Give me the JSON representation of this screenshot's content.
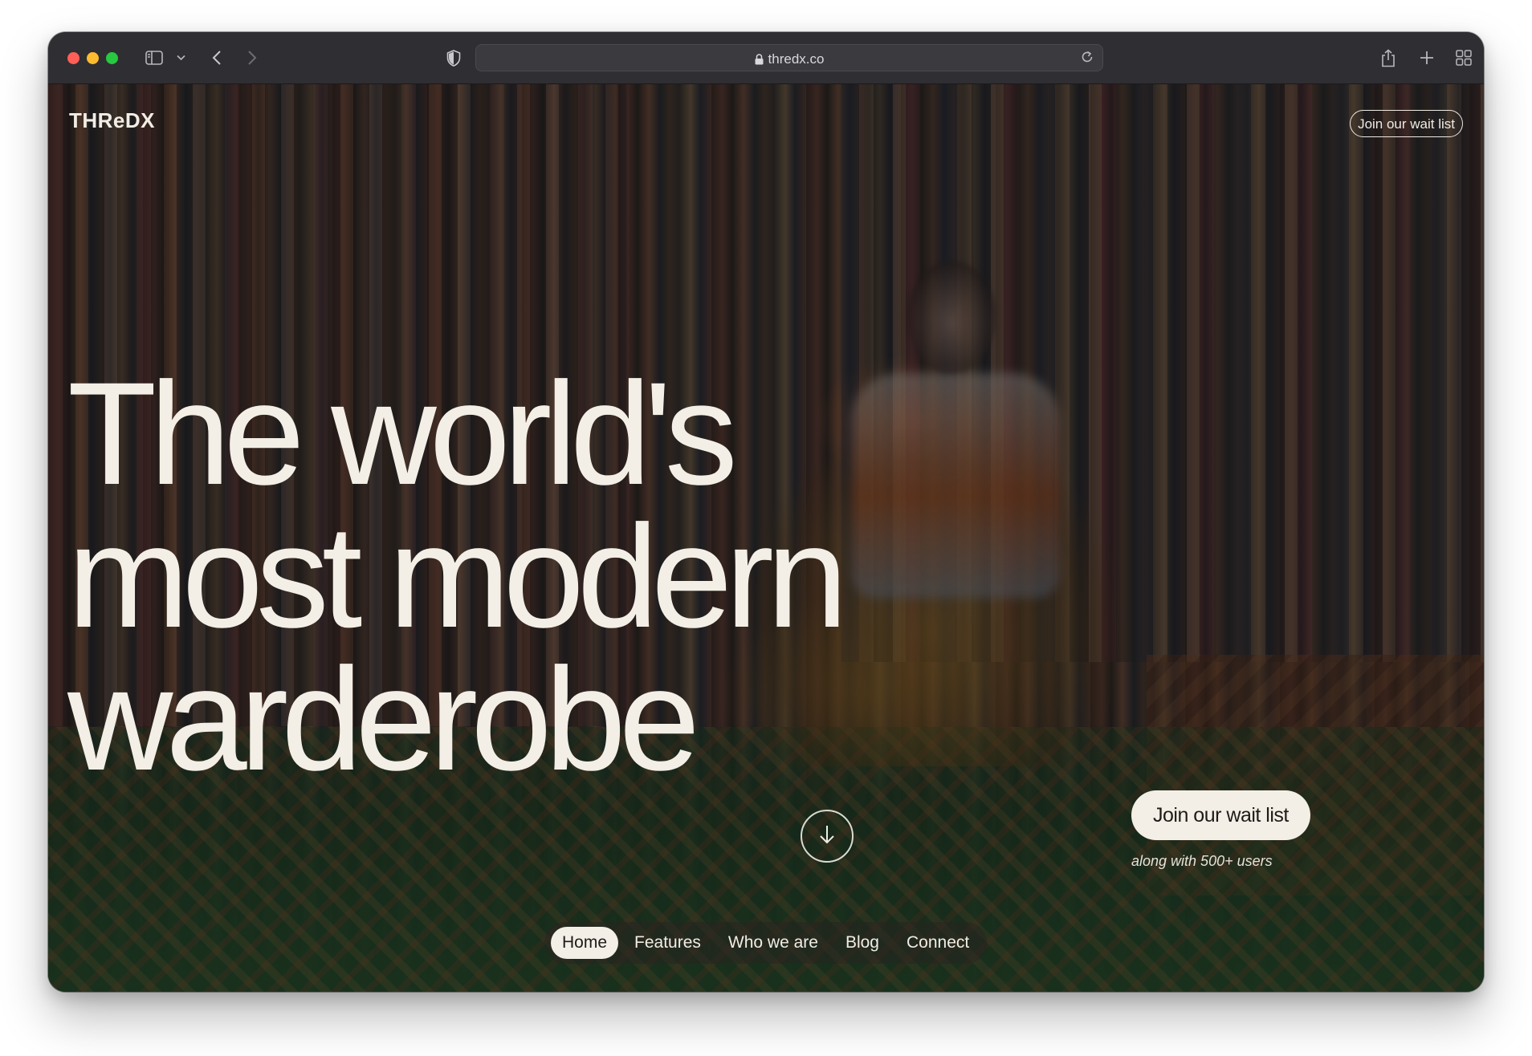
{
  "browser": {
    "url": "thredx.co",
    "icons": {
      "sidebar": "sidebar-icon",
      "chevron": "chevron-down-icon",
      "back": "back-arrow-icon",
      "forward": "forward-arrow-icon",
      "shield": "shield-icon",
      "lock": "lock-icon",
      "reload": "reload-icon",
      "share": "share-icon",
      "new_tab": "plus-icon",
      "tab_overview": "tab-grid-icon"
    }
  },
  "site": {
    "logo": "THReDX",
    "top_cta": "Join our wait list",
    "headline": {
      "line1": "The world's",
      "line2": "most modern",
      "line3": "warderobe"
    },
    "scroll_icon": "arrow-down-icon",
    "cta": {
      "label": "Join our wait list",
      "subtext": "along with 500+ users"
    },
    "nav": [
      {
        "label": "Home",
        "active": true
      },
      {
        "label": "Features",
        "active": false
      },
      {
        "label": "Who we are",
        "active": false
      },
      {
        "label": "Blog",
        "active": false
      },
      {
        "label": "Connect",
        "active": false
      }
    ]
  },
  "colors": {
    "text_light": "#f3efe6",
    "button_bg": "#f3efe6",
    "button_text": "#1e1b18",
    "chrome_bg": "#2f2e32"
  }
}
